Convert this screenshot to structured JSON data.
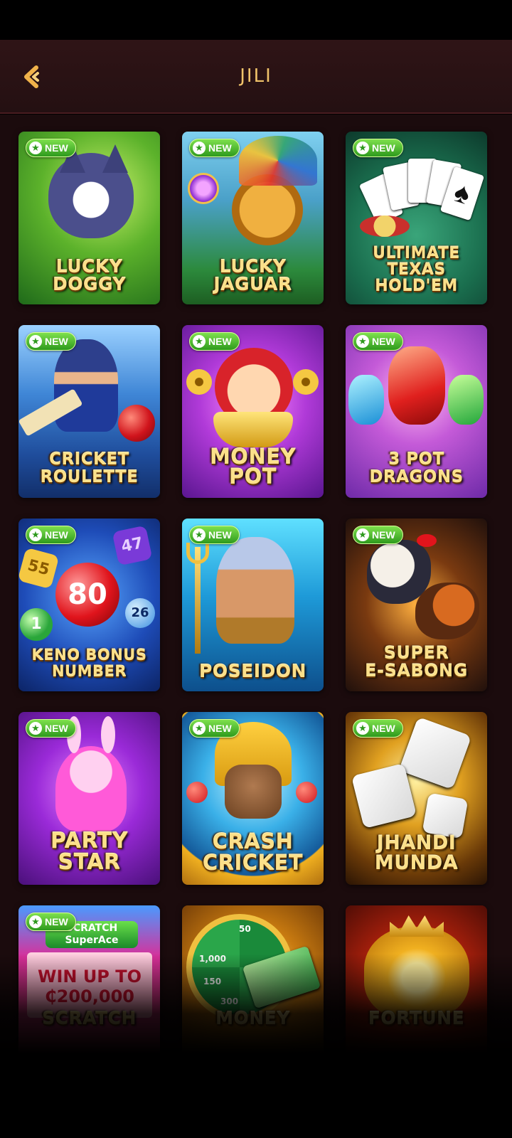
{
  "header": {
    "title": "JILI"
  },
  "badge_text": "NEW",
  "games": [
    {
      "name": "LUCKY\nDOGGY",
      "is_new": true
    },
    {
      "name": "LUCKY\nJAGUAR",
      "is_new": true
    },
    {
      "name": "ULTIMATE\nTEXAS\nHOLD'EM",
      "is_new": true
    },
    {
      "name": "CRICKET\nROULETTE",
      "is_new": true
    },
    {
      "name": "MONEY\nPOT",
      "is_new": true
    },
    {
      "name": "3 POT\nDRAGONS",
      "is_new": true
    },
    {
      "name": "KENO BONUS\nNUMBER",
      "is_new": true
    },
    {
      "name": "POSEIDON",
      "is_new": true
    },
    {
      "name": "SUPER\nE-SABONG",
      "is_new": true
    },
    {
      "name": "PARTY\nSTAR",
      "is_new": true
    },
    {
      "name": "CRASH\nCRICKET",
      "is_new": true
    },
    {
      "name": "JHANDI\nMUNDA",
      "is_new": true
    },
    {
      "name": "SCRATCH",
      "is_new": true
    },
    {
      "name": "MONEY",
      "is_new": false
    },
    {
      "name": "FORTUNE",
      "is_new": false
    }
  ],
  "scratch_card": {
    "brand": "SCRATCH SuperAce",
    "offer": "WIN UP TO\n₵200,000"
  },
  "keno_balls": [
    "80",
    "55",
    "47",
    "26",
    "1"
  ],
  "wheel_values": [
    "50",
    "1,000",
    "150",
    "300"
  ],
  "colors": {
    "accent": "#f0c36a",
    "header_bg": "#2f1416",
    "content_bg": "#1b0b0d",
    "badge_green": "#4cbf2f"
  },
  "icons": {
    "back": "chevron-left-icon",
    "badge": "star-icon"
  }
}
